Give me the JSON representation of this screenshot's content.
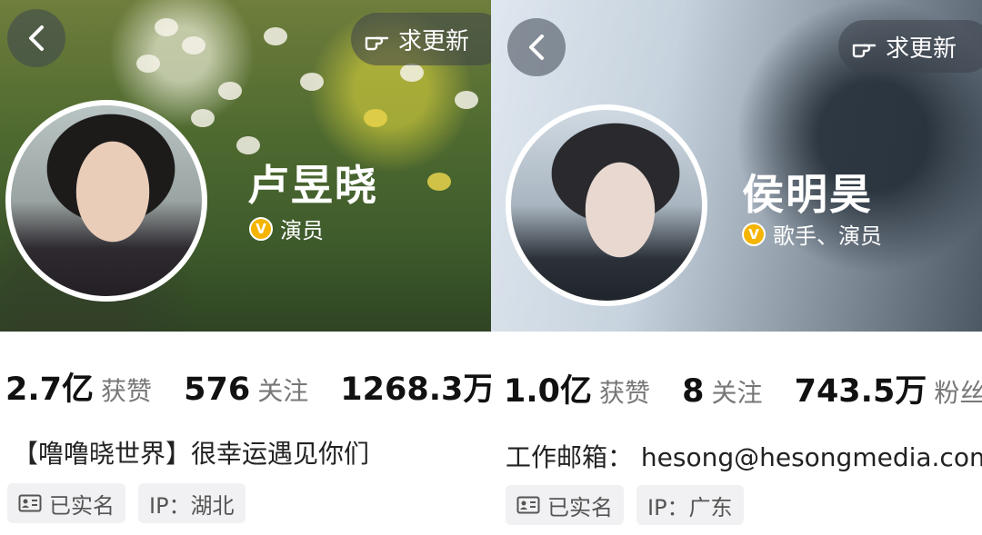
{
  "profiles": [
    {
      "name": "卢昱晓",
      "verified_role": "演员",
      "update_label": "求更新",
      "stats": [
        {
          "value": "2.7亿",
          "label": "获赞"
        },
        {
          "value": "576",
          "label": "关注"
        },
        {
          "value": "1268.3万",
          "label": ""
        }
      ],
      "bio": "【噜噜晓世界】很幸运遇见你们",
      "tags": {
        "realname": "已实名",
        "ip": "IP：湖北"
      }
    },
    {
      "name": "侯明昊",
      "verified_role": "歌手、演员",
      "update_label": "求更新",
      "stats": [
        {
          "value": "1.0亿",
          "label": "获赞"
        },
        {
          "value": "8",
          "label": "关注"
        },
        {
          "value": "743.5万",
          "label": "粉丝"
        }
      ],
      "bio": "工作邮箱：  hesong@hesongmedia.com",
      "tags": {
        "realname": "已实名",
        "ip": "IP：广东"
      }
    }
  ],
  "icons": {
    "back": "chevron-left-icon",
    "update": "pointing-hand-icon",
    "verified": "verified-v-icon",
    "idcard": "id-card-icon"
  },
  "colors": {
    "verified_badge": "#f4b400",
    "tag_bg": "#f1f1f3"
  }
}
